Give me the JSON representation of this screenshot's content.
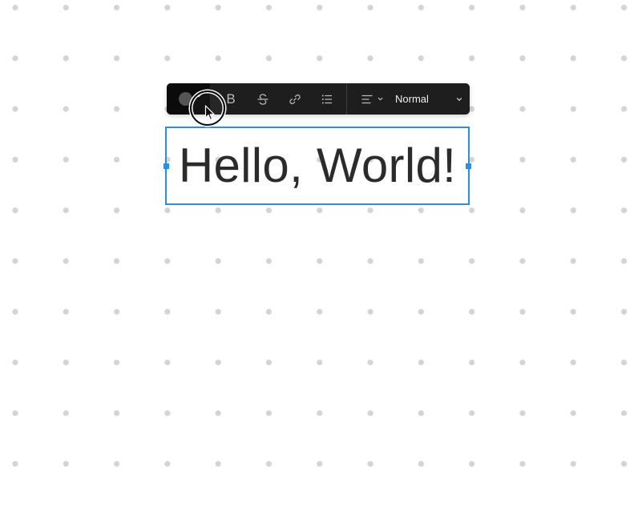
{
  "toolbar": {
    "color_swatch": "#555555",
    "bold_label": "B",
    "text_style": "Normal"
  },
  "editor": {
    "text": "Hello, World!"
  },
  "colors": {
    "selection": "#2490e8",
    "toolbar_bg": "#1e1e1e",
    "text": "#2b2b2b"
  },
  "icons": [
    "chevron-down-icon",
    "strikethrough-icon",
    "link-icon",
    "list-icon",
    "align-left-icon",
    "cursor-icon"
  ]
}
